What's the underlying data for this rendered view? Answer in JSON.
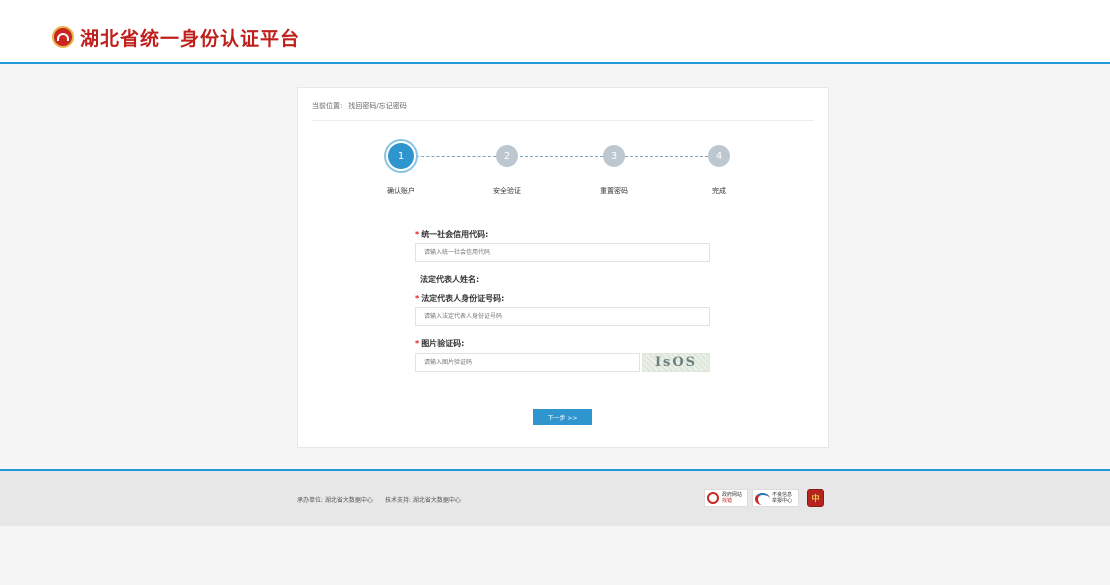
{
  "header": {
    "site_title": "湖北省统一身份认证平台"
  },
  "breadcrumb": {
    "prefix": "当前位置:",
    "current": "找回密码/忘记密码"
  },
  "steps": [
    {
      "number": "1",
      "label": "确认账户",
      "active": true
    },
    {
      "number": "2",
      "label": "安全验证",
      "active": false
    },
    {
      "number": "3",
      "label": "重置密码",
      "active": false
    },
    {
      "number": "4",
      "label": "完成",
      "active": false
    }
  ],
  "form": {
    "credit_code": {
      "required": true,
      "label": "统一社会信用代码:",
      "placeholder": "请输入统一社会信用代码",
      "value": ""
    },
    "legal_rep_name": {
      "required": false,
      "label": "法定代表人姓名:"
    },
    "legal_rep_id": {
      "required": true,
      "label": "法定代表人身份证号码:",
      "placeholder": "请输入法定代表人身份证号码",
      "value": ""
    },
    "captcha": {
      "required": true,
      "label": "图片验证码:",
      "placeholder": "请输入图片验证码",
      "value": "",
      "image_text": "IsOS"
    },
    "required_mark": "*",
    "next_button": "下一步 >>"
  },
  "footer": {
    "host_unit": "承办单位: 湖北省大数据中心",
    "tech_support": "技术支持: 湖北省大数据中心",
    "badge_gov_line1": "政府网站",
    "badge_gov_line2": "找错",
    "badge_report_line1": "不良信息",
    "badge_report_line2": "举报中心",
    "badge_party": "中"
  },
  "colors": {
    "accent": "#2f95cf",
    "brand_red": "#c0201b",
    "header_rule": "#1e9bd7",
    "step_inactive": "#bdc7cf"
  }
}
